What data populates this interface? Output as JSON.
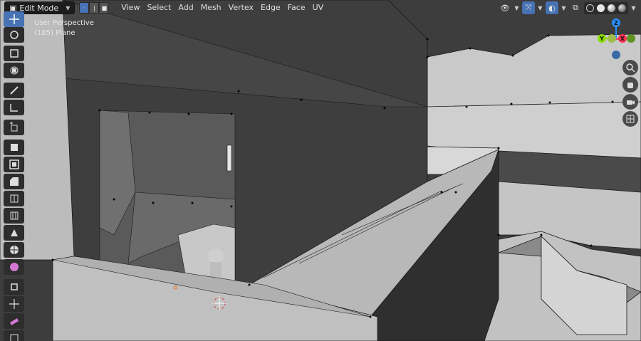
{
  "header": {
    "mode_label": "Edit Mode",
    "menu": [
      "View",
      "Select",
      "Add",
      "Mesh",
      "Vertex",
      "Edge",
      "Face",
      "UV"
    ]
  },
  "viewport": {
    "view_name": "User Perspective",
    "object_info": "(185) Plane"
  },
  "gizmo": {
    "z_label": "Z",
    "y_label": "Y",
    "x_label": "X"
  },
  "colors": {
    "accent": "#4772b3",
    "x_axis": "#ff3352",
    "y_axis": "#8bdc00",
    "z_axis": "#2890ff"
  },
  "icons": {
    "toolbar": [
      "select-box-icon",
      "move-icon",
      "rotate-icon",
      "scale-icon",
      "transform-icon",
      "annotate-icon",
      "measure-icon",
      "add-cube-icon",
      "extrude-icon",
      "inset-icon",
      "bevel-icon",
      "loop-cut-icon",
      "offset-edge-loop-icon",
      "poly-build-icon",
      "spin-icon",
      "smooth-icon",
      "shrink-fatten-icon",
      "shear-icon",
      "rip-icon"
    ],
    "nav": [
      "zoom-icon",
      "hand-icon",
      "camera-icon",
      "grid-icon"
    ]
  }
}
